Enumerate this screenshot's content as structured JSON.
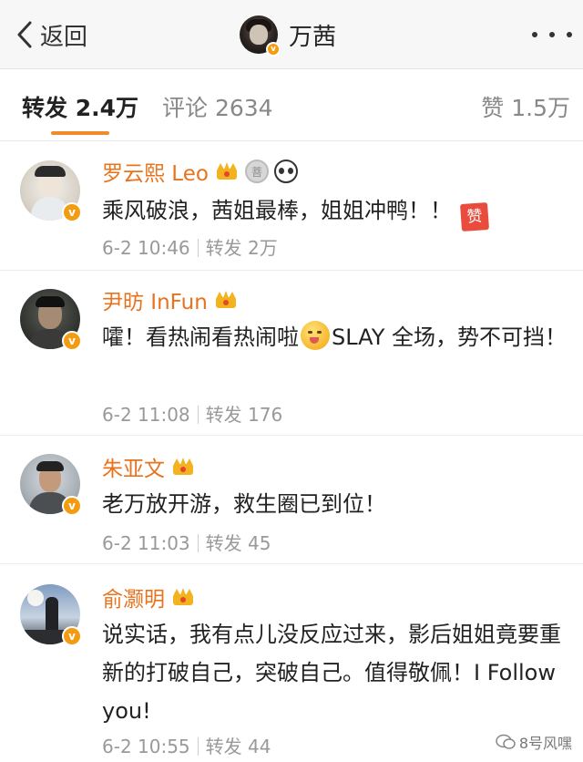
{
  "nav": {
    "back_label": "返回",
    "title": "万茜",
    "icons": {
      "back": "chevron-left-icon",
      "more": "more-dots-icon",
      "verified": "verified-badge-icon"
    }
  },
  "tabs": [
    {
      "label": "转发 2.4万",
      "active": true
    },
    {
      "label": "评论 2634",
      "active": false
    },
    {
      "label": "赞 1.5万",
      "active": false
    }
  ],
  "comments": [
    {
      "name": "罗云熙 Leo",
      "badges": [
        "crown-icon",
        "medal-icon",
        "panda-icon"
      ],
      "text": "乘风破浪，茜姐最棒，姐姐冲鸭！！",
      "sticker": "赞",
      "time": "6-2 10:46",
      "repost": "转发 2万"
    },
    {
      "name": "尹昉 InFun",
      "badges": [
        "crown-icon"
      ],
      "text_before": "嚯！看热闹看热闹啦",
      "text_after": "SLAY 全场，势不可挡！",
      "emoji": "yum-emoji-icon",
      "time": "6-2 11:08",
      "repost": "转发 176"
    },
    {
      "name": "朱亚文",
      "badges": [
        "crown-icon"
      ],
      "text": "老万放开游，救生圈已到位！",
      "time": "6-2 11:03",
      "repost": "转发 45"
    },
    {
      "name": "俞灏明",
      "badges": [
        "crown-icon"
      ],
      "text": "说实话，我有点儿没反应过来，影后姐姐竟要重新的打破自己，突破自己。值得敬佩！I Follow you!",
      "time": "6-2 10:55",
      "repost": "转发 44"
    }
  ],
  "watermark": "8号风嘿",
  "colors": {
    "accent": "#f08c2b",
    "name": "#e8731c",
    "verified": "#f39c12",
    "meta": "#999999"
  }
}
